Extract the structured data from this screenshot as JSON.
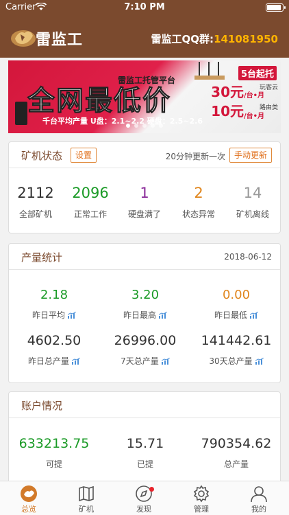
{
  "status_bar": {
    "carrier": "Carrier",
    "time": "7:10 PM"
  },
  "nav": {
    "logo_text": "雷监工",
    "qq_label": "雷监工QQ群:",
    "qq_number": "141081950"
  },
  "banner": {
    "platform": "雷监工托管平台",
    "headline": "全网最低价",
    "tag": "5台起托",
    "price1": "30元",
    "price1_unit": "/台•月",
    "price1_label": "玩客云",
    "price2": "10元",
    "price2_unit": "/台•月",
    "price2_label": "路由类",
    "sub": "千台平均产量  U盘：2.1~2.2  硬盘：2.5~2.6"
  },
  "miner_status": {
    "title": "矿机状态",
    "settings_button": "设置",
    "refresh_note": "20分钟更新一次",
    "manual_refresh_button": "手动更新",
    "stats": [
      {
        "value": "2112",
        "label": "全部矿机",
        "color": "#222222"
      },
      {
        "value": "2096",
        "label": "正常工作",
        "color": "#1a9a26"
      },
      {
        "value": "1",
        "label": "硬盘满了",
        "color": "#8a2a9a"
      },
      {
        "value": "2",
        "label": "状态异常",
        "color": "#e0851c"
      },
      {
        "value": "14",
        "label": "矿机离线",
        "color": "#999999"
      }
    ]
  },
  "production": {
    "title": "产量统计",
    "date": "2018-06-12",
    "row1": [
      {
        "value": "2.18",
        "label": "昨日平均",
        "color": "#1a9a26"
      },
      {
        "value": "3.20",
        "label": "昨日最高",
        "color": "#1a9a26"
      },
      {
        "value": "0.00",
        "label": "昨日最低",
        "color": "#e0851c"
      }
    ],
    "row2": [
      {
        "value": "4602.50",
        "label": "昨日总产量",
        "color": "#222222"
      },
      {
        "value": "26996.00",
        "label": "7天总产量",
        "color": "#222222"
      },
      {
        "value": "141442.61",
        "label": "30天总产量",
        "color": "#222222"
      }
    ]
  },
  "account": {
    "title": "账户情况",
    "stats": [
      {
        "value": "633213.75",
        "label": "可提",
        "color": "#1a9a26"
      },
      {
        "value": "15.71",
        "label": "已提",
        "color": "#222222"
      },
      {
        "value": "790354.62",
        "label": "总产量",
        "color": "#222222"
      }
    ]
  },
  "tabs": [
    {
      "label": "总览",
      "icon": "overview-icon"
    },
    {
      "label": "矿机",
      "icon": "map-icon"
    },
    {
      "label": "发现",
      "icon": "compass-icon"
    },
    {
      "label": "管理",
      "icon": "gear-icon"
    },
    {
      "label": "我的",
      "icon": "user-icon"
    }
  ],
  "colors": {
    "brand": "#7b4a2e",
    "accent": "#e0701c",
    "active_tab": "#d27a2a"
  }
}
